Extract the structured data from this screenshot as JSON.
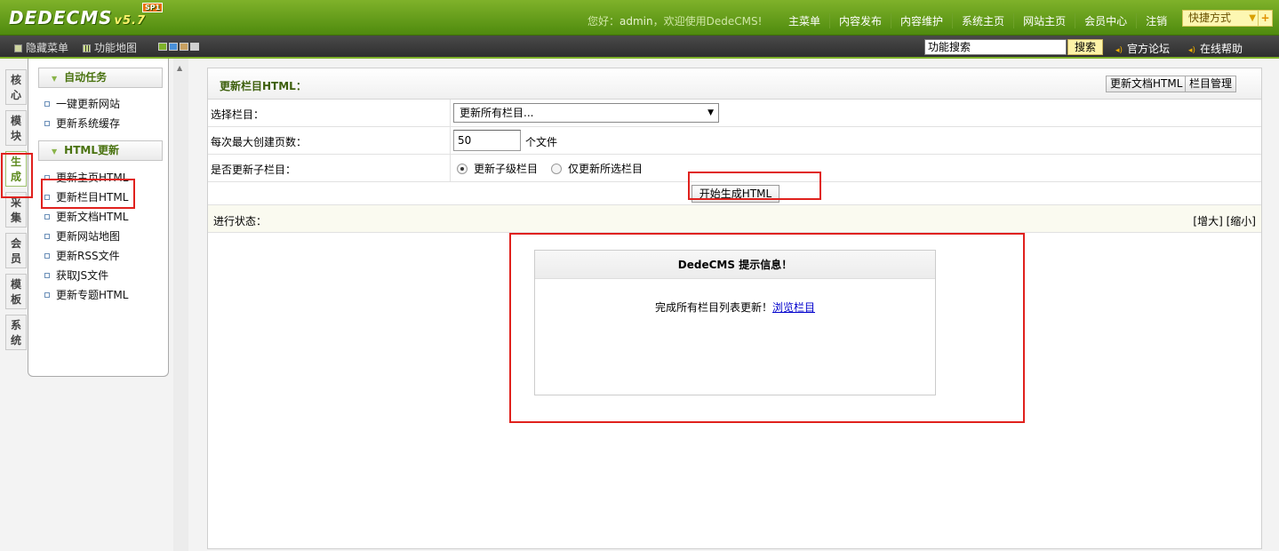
{
  "header": {
    "logo_text": "DEDECMS",
    "logo_version": "v5.7",
    "logo_badge": "SP1",
    "welcome_prefix": "您好：",
    "username": "admin",
    "welcome_suffix": "，欢迎使用DedeCMS!",
    "nav": [
      "主菜单",
      "内容发布",
      "内容维护",
      "系统主页",
      "网站主页",
      "会员中心",
      "注销"
    ],
    "quick_label": "快捷方式",
    "quick_plus": "+"
  },
  "subbar": {
    "hide_menu": "隐藏菜单",
    "site_map": "功能地图",
    "theme_colors": [
      "#7fb22a",
      "#4a90d9",
      "#c8a060",
      "#d0d0d0"
    ],
    "search_value": "功能搜索",
    "search_button": "搜索",
    "forum_link": "官方论坛",
    "help_link": "在线帮助"
  },
  "vtabs": [
    {
      "label": "核心",
      "active": false
    },
    {
      "label": "模块",
      "active": false
    },
    {
      "label": "生成",
      "active": true
    },
    {
      "label": "采集",
      "active": false
    },
    {
      "label": "会员",
      "active": false
    },
    {
      "label": "模板",
      "active": false
    },
    {
      "label": "系统",
      "active": false
    }
  ],
  "menu": {
    "groups": [
      {
        "title": "自动任务",
        "items": [
          "一键更新网站",
          "更新系统缓存"
        ]
      },
      {
        "title": "HTML更新",
        "items": [
          "更新主页HTML",
          "更新栏目HTML",
          "更新文档HTML",
          "更新网站地图",
          "更新RSS文件",
          "获取JS文件",
          "更新专题HTML"
        ]
      }
    ]
  },
  "main": {
    "title": "更新栏目HTML：",
    "btn_update_doc": "更新文档HTML",
    "btn_manage_cat": "栏目管理",
    "label_select": "选择栏目：",
    "select_value": "更新所有栏目...",
    "label_pages": "每次最大创建页数：",
    "pages_value": "50",
    "pages_unit": "个文件",
    "label_sub": "是否更新子栏目：",
    "radio_sub": "更新子级栏目",
    "radio_only": "仅更新所选栏目",
    "start_button": "开始生成HTML",
    "status_label": "进行状态：",
    "zoom_in": "[增大]",
    "zoom_out": "[缩小]"
  },
  "message": {
    "title": "DedeCMS 提示信息！",
    "text": "完成所有栏目列表更新！",
    "link": "浏览栏目"
  }
}
